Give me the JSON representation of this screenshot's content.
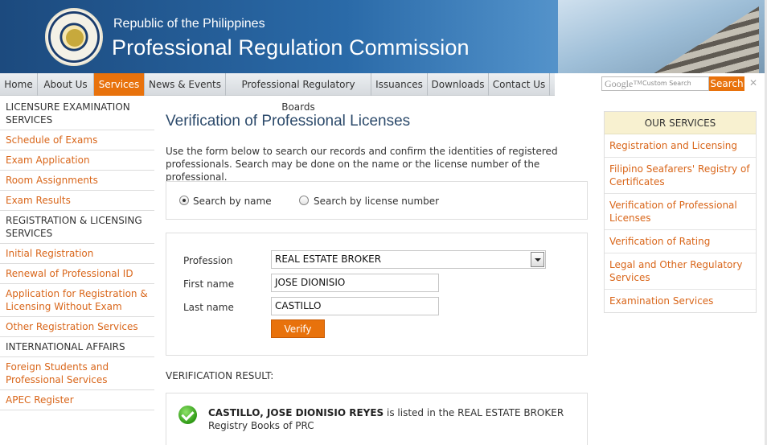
{
  "header": {
    "subtitle": "Republic of the Philippines",
    "title": "Professional Regulation Commission"
  },
  "nav": {
    "items": [
      {
        "label": "Home"
      },
      {
        "label": "About Us"
      },
      {
        "label": "Services"
      },
      {
        "label": "News & Events"
      },
      {
        "label": "Professional Regulatory Boards"
      },
      {
        "label": "Issuances"
      },
      {
        "label": "Downloads"
      },
      {
        "label": "Contact Us"
      }
    ],
    "active": "Services"
  },
  "search": {
    "brand": "Google™",
    "placeholder": "Custom Search",
    "button_label": "Search",
    "clear_label": "✕"
  },
  "left_sidebar": {
    "items": [
      {
        "label": "LICENSURE EXAMINATION SERVICES",
        "kind": "heading"
      },
      {
        "label": "Schedule of Exams",
        "kind": "link"
      },
      {
        "label": "Exam Application",
        "kind": "link"
      },
      {
        "label": "Room Assignments",
        "kind": "link"
      },
      {
        "label": "Exam Results",
        "kind": "link"
      },
      {
        "label": "REGISTRATION & LICENSING SERVICES",
        "kind": "heading"
      },
      {
        "label": "Initial Registration",
        "kind": "link"
      },
      {
        "label": "Renewal of Professional ID",
        "kind": "link"
      },
      {
        "label": "Application for Registration & Licensing Without Exam",
        "kind": "link"
      },
      {
        "label": "Other Registration Services",
        "kind": "link"
      },
      {
        "label": "INTERNATIONAL AFFAIRS",
        "kind": "heading"
      },
      {
        "label": "Foreign Students and Professional Services",
        "kind": "link"
      },
      {
        "label": "APEC Register",
        "kind": "link"
      }
    ]
  },
  "main": {
    "title": "Verification of Professional Licenses",
    "intro": "Use the form below to search our records and confirm the identities of registered professionals. Search may be done on the name or the license number of the professional.",
    "search_mode": {
      "by_name_label": "Search by name",
      "by_license_label": "Search by license number",
      "selected": "by_name"
    },
    "form": {
      "profession_label": "Profession",
      "profession_value": "REAL ESTATE BROKER",
      "first_name_label": "First name",
      "first_name_value": "JOSE DIONISIO",
      "last_name_label": "Last name",
      "last_name_value": "CASTILLO",
      "verify_label": "Verify"
    },
    "result": {
      "heading": "VERIFICATION RESULT:",
      "name": "CASTILLO, JOSE DIONISIO REYES",
      "message": " is listed in the REAL ESTATE BROKER Registry Books of PRC"
    }
  },
  "right_sidebar": {
    "heading": "OUR SERVICES",
    "items": [
      {
        "label": "Registration and Licensing"
      },
      {
        "label": "Filipino Seafarers' Registry of Certificates"
      },
      {
        "label": "Verification of Professional Licenses"
      },
      {
        "label": "Verification of Rating"
      },
      {
        "label": "Legal and Other Regulatory Services"
      },
      {
        "label": "Examination Services"
      }
    ]
  },
  "colors": {
    "accent": "#e8720c",
    "link": "#d9661a",
    "title": "#2c4a6b",
    "banner": "#2a6aa8"
  }
}
